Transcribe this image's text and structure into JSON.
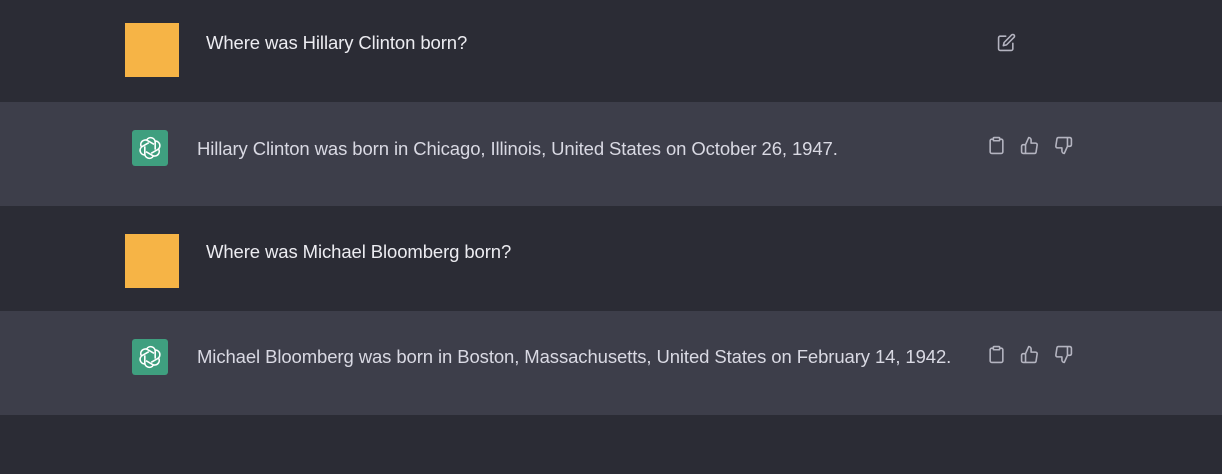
{
  "conversation": {
    "messages": [
      {
        "role": "user",
        "text": "Where was Hillary Clinton born?",
        "actions": [
          "edit-icon"
        ]
      },
      {
        "role": "assistant",
        "text": "Hillary Clinton was born in Chicago, Illinois, United States on October 26, 1947.",
        "actions": [
          "clipboard-icon",
          "thumbs-up-icon",
          "thumbs-down-icon"
        ]
      },
      {
        "role": "user",
        "text": "Where was Michael Bloomberg born?",
        "actions": []
      },
      {
        "role": "assistant",
        "text": "Michael Bloomberg was born in Boston, Massachusetts, United States on February 14, 1942.",
        "actions": [
          "clipboard-icon",
          "thumbs-up-icon",
          "thumbs-down-icon"
        ]
      }
    ]
  },
  "colors": {
    "user_row_bg": "#2b2c35",
    "assistant_row_bg": "#3d3e4a",
    "user_avatar": "#f6b446",
    "assistant_avatar": "#3f9f7f"
  }
}
